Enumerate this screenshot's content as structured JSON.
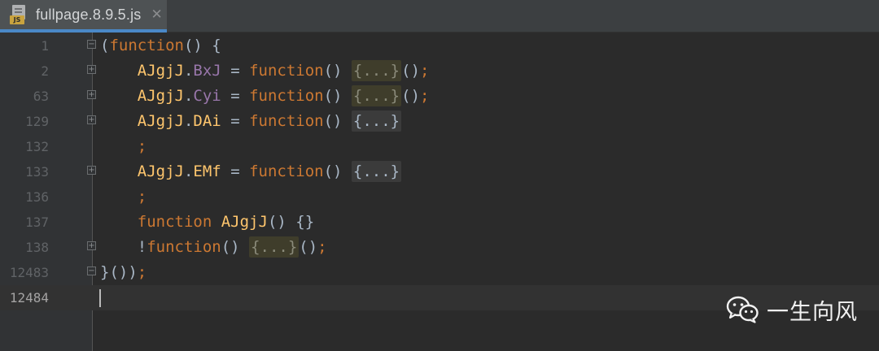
{
  "tab": {
    "title": "fullpage.8.9.5.js",
    "close_glyph": "✕",
    "file_badge": "JS"
  },
  "editor": {
    "lines": [
      {
        "num": "1",
        "fold": "⊖"
      },
      {
        "num": "2",
        "fold": "⊞"
      },
      {
        "num": "63",
        "fold": "⊞"
      },
      {
        "num": "129",
        "fold": "⊞"
      },
      {
        "num": "132",
        "fold": ""
      },
      {
        "num": "133",
        "fold": "⊞"
      },
      {
        "num": "136",
        "fold": ""
      },
      {
        "num": "137",
        "fold": ""
      },
      {
        "num": "138",
        "fold": "⊞"
      },
      {
        "num": "12483",
        "fold": "⊖"
      },
      {
        "num": "12484",
        "fold": ""
      }
    ],
    "tokens": {
      "open_paren": "(",
      "function_kw": "function",
      "call_brace_open": "() {",
      "indent": "    ",
      "obj": "AJgjJ",
      "dot": ".",
      "prop_bxj": "BxJ",
      "prop_cyi": "Cyi",
      "prop_dai": "DAi",
      "prop_emf": "EMf",
      "assign": " = ",
      "parens": "() ",
      "folded": "{...}",
      "invoke": "()",
      "semicolon": ";",
      "fn_decl_name": "AJgjJ",
      "fn_decl_tail": "() {}",
      "bang": "!",
      "close": "}())",
      "space": " "
    }
  },
  "watermark": {
    "text": "一生向风",
    "icon": "wechat-icon"
  },
  "colors": {
    "background": "#2b2b2b",
    "keyword": "#cc7832",
    "function_name": "#ffc66d",
    "property": "#9876aa",
    "default_text": "#a9b7c6",
    "tab_underline": "#4a88c7"
  }
}
